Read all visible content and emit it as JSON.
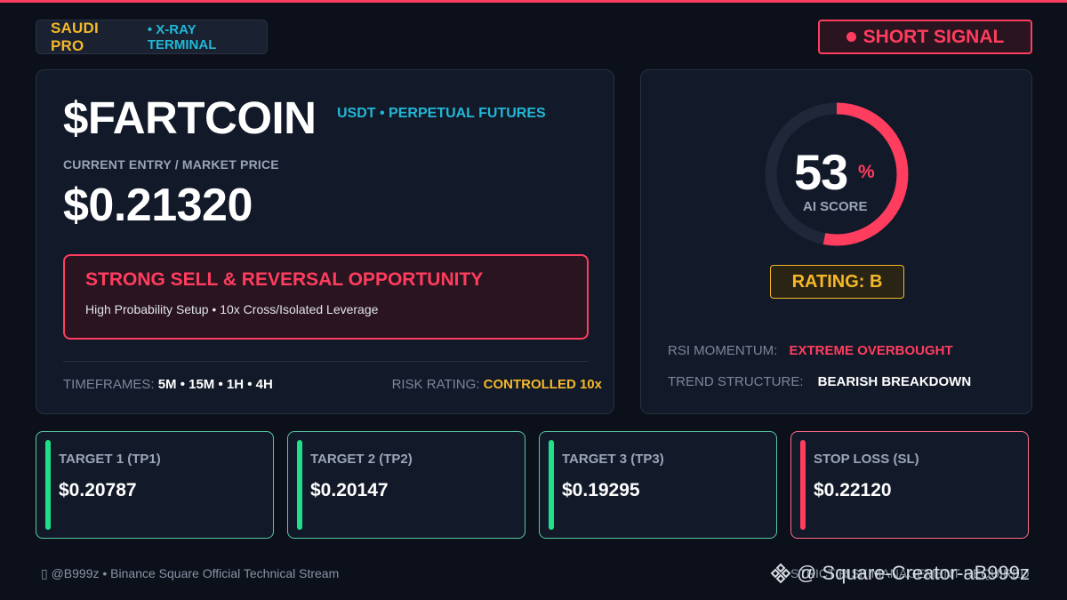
{
  "brand": {
    "name": "SAUDI PRO",
    "subtitle": "• X-RAY TERMINAL"
  },
  "signal": {
    "label": "SHORT SIGNAL"
  },
  "asset": {
    "symbol": "$FARTCOIN",
    "pair": "USDT • PERPETUAL FUTURES",
    "price_label": "CURRENT ENTRY / MARKET PRICE",
    "price": "$0.21320"
  },
  "alert": {
    "title": "STRONG SELL & REVERSAL OPPORTUNITY",
    "subtitle": "High Probability Setup • 10x Cross/Isolated Leverage"
  },
  "timeframes": {
    "label": "TIMEFRAMES:",
    "value": "5M • 15M • 1H • 4H"
  },
  "risk": {
    "label": "RISK RATING:",
    "value": "CONTROLLED 10x"
  },
  "score": {
    "value": "53",
    "unit": "%",
    "label": "AI SCORE",
    "fraction": 0.53
  },
  "rating": {
    "label": "RATING: B"
  },
  "stats": [
    {
      "label": "RSI MOMENTUM:",
      "value": "EXTREME OVERBOUGHT"
    },
    {
      "label": "TREND STRUCTURE:",
      "value": "BEARISH BREAKDOWN"
    }
  ],
  "targets": [
    {
      "label": "TARGET 1 (TP1)",
      "value": "$0.20787"
    },
    {
      "label": "TARGET 2 (TP2)",
      "value": "$0.20147"
    },
    {
      "label": "TARGET 3 (TP3)",
      "value": "$0.19295"
    },
    {
      "label": "STOP LOSS (SL)",
      "value": "$0.22120"
    }
  ],
  "footer": {
    "left": "▯ @B999z • Binance Square Official Technical Stream",
    "right": "STRICT RISK MANAGEMENT REQUIRED"
  },
  "watermark": {
    "text": "@ Square-Creator-aB999z"
  },
  "colors": {
    "accent_red": "#ff3d5e",
    "accent_gold": "#f5b82a",
    "accent_cyan": "#22b7d6",
    "accent_green": "#1fe08a",
    "background": "#0b101a",
    "card": "#121929"
  }
}
